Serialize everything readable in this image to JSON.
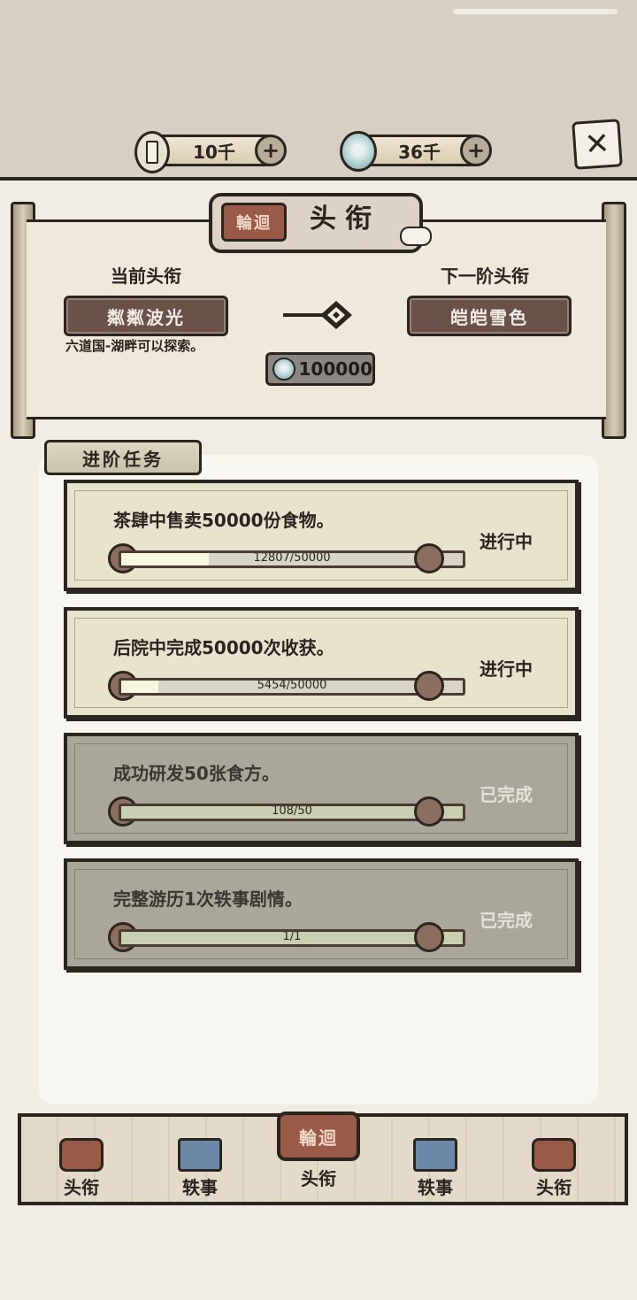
{
  "header": {
    "coins": {
      "value": "10千",
      "icon": "coin-icon"
    },
    "gems": {
      "value": "36千",
      "icon": "gem-icon"
    },
    "plus": "+",
    "close": "✕"
  },
  "title_panel": {
    "seal_text": "輪迴",
    "title": "头衔",
    "current_label": "当前头衔",
    "current_rank": "粼粼波光",
    "unlock_text": "六道国-湖畔可以探索。",
    "next_label": "下一阶头衔",
    "next_rank": "皑皑雪色",
    "cost": "100000"
  },
  "tasks": {
    "header": "进阶任务",
    "items": [
      {
        "desc": "茶肆中售卖50000份食物。",
        "progress": "12807/50000",
        "ratio": 0.256,
        "status": "进行中",
        "state": "active"
      },
      {
        "desc": "后院中完成50000次收获。",
        "progress": "5454/50000",
        "ratio": 0.109,
        "status": "进行中",
        "state": "active"
      },
      {
        "desc": "成功研发50张食方。",
        "progress": "108/50",
        "ratio": 1.0,
        "status": "已完成",
        "state": "done"
      },
      {
        "desc": "完整游历1次轶事剧情。",
        "progress": "1/1",
        "ratio": 1.0,
        "status": "已完成",
        "state": "done"
      }
    ]
  },
  "nav": {
    "items": [
      {
        "label": "头衔",
        "icon": "seal-icon"
      },
      {
        "label": "轶事",
        "icon": "scroll-icon"
      },
      {
        "label": "头衔",
        "icon": "seal-icon",
        "seal_text": "輪迴"
      },
      {
        "label": "轶事",
        "icon": "scroll-icon"
      },
      {
        "label": "头衔",
        "icon": "seal-icon"
      }
    ]
  }
}
